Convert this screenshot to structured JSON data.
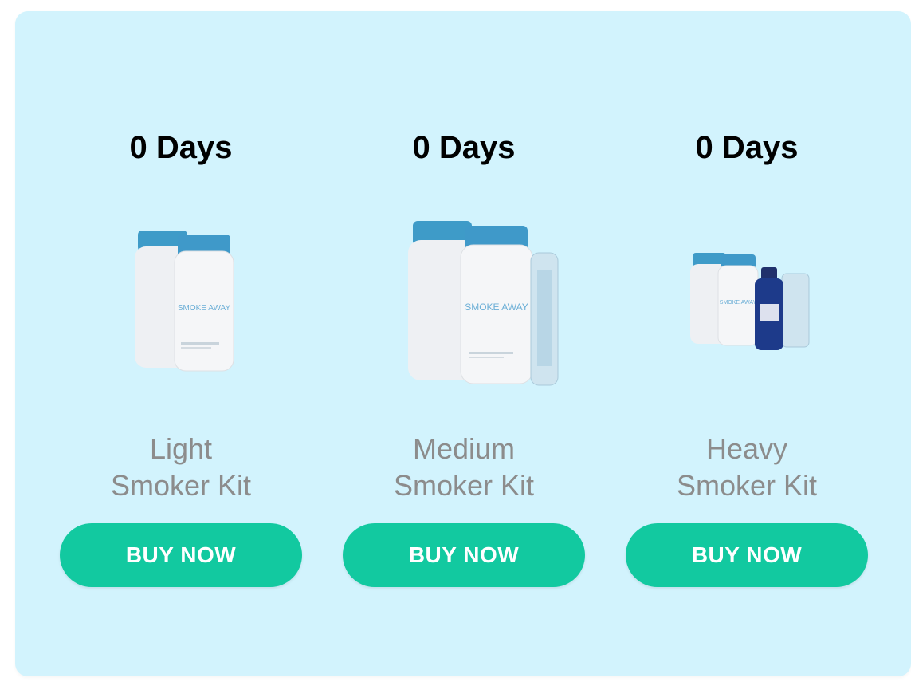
{
  "products": [
    {
      "days_label": "0 Days",
      "name_line1": "Light",
      "name_line2": "Smoker Kit",
      "button_label": "BUY NOW",
      "image_label": "SMOKE AWAY"
    },
    {
      "days_label": "0 Days",
      "name_line1": "Medium",
      "name_line2": "Smoker Kit",
      "button_label": "BUY NOW",
      "image_label": "SMOKE AWAY"
    },
    {
      "days_label": "0 Days",
      "name_line1": "Heavy",
      "name_line2": "Smoker Kit",
      "button_label": "BUY NOW",
      "image_label": "SMOKE AWAY"
    }
  ],
  "colors": {
    "panel_background": "#d2f3fd",
    "button": "#12c9a0",
    "button_text": "#ffffff",
    "kit_name_text": "#8c8c8c",
    "bottle_cap": "#3e9bc8",
    "bottle_body": "#f3f4f6"
  }
}
